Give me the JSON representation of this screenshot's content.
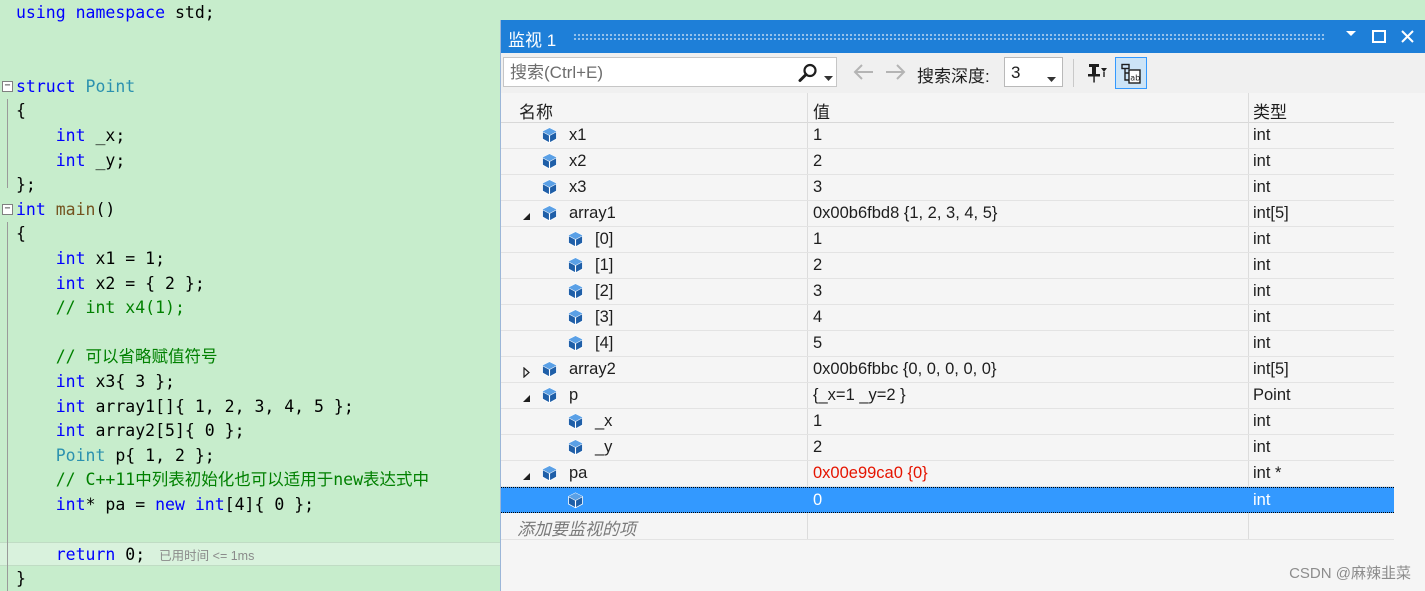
{
  "editor": {
    "lines": [
      {
        "segs": [
          {
            "t": "using",
            "c": "kw"
          },
          {
            "t": " ",
            "c": "pl"
          },
          {
            "t": "namespace",
            "c": "kw"
          },
          {
            "t": " std;",
            "c": "pl"
          }
        ]
      },
      {
        "segs": []
      },
      {
        "segs": []
      },
      {
        "segs": [
          {
            "t": "struct",
            "c": "kw"
          },
          {
            "t": " ",
            "c": "pl"
          },
          {
            "t": "Point",
            "c": "ty"
          }
        ],
        "fold": "−"
      },
      {
        "segs": [
          {
            "t": "{",
            "c": "pl"
          }
        ]
      },
      {
        "segs": [
          {
            "t": "    ",
            "c": "pl"
          },
          {
            "t": "int",
            "c": "kw"
          },
          {
            "t": " _x;",
            "c": "pl"
          }
        ]
      },
      {
        "segs": [
          {
            "t": "    ",
            "c": "pl"
          },
          {
            "t": "int",
            "c": "kw"
          },
          {
            "t": " _y;",
            "c": "pl"
          }
        ]
      },
      {
        "segs": [
          {
            "t": "};",
            "c": "pl"
          }
        ]
      },
      {
        "segs": [
          {
            "t": "int",
            "c": "kw"
          },
          {
            "t": " ",
            "c": "pl"
          },
          {
            "t": "main",
            "c": "fn"
          },
          {
            "t": "()",
            "c": "pl"
          }
        ],
        "fold": "−"
      },
      {
        "segs": [
          {
            "t": "{",
            "c": "pl"
          }
        ]
      },
      {
        "segs": [
          {
            "t": "    ",
            "c": "pl"
          },
          {
            "t": "int",
            "c": "kw"
          },
          {
            "t": " x1 = 1;",
            "c": "pl"
          }
        ]
      },
      {
        "segs": [
          {
            "t": "    ",
            "c": "pl"
          },
          {
            "t": "int",
            "c": "kw"
          },
          {
            "t": " x2 = { 2 };",
            "c": "pl"
          }
        ]
      },
      {
        "segs": [
          {
            "t": "    // int x4(1);",
            "c": "cm"
          }
        ]
      },
      {
        "segs": []
      },
      {
        "segs": [
          {
            "t": "    // 可以省略赋值符号",
            "c": "cm"
          }
        ]
      },
      {
        "segs": [
          {
            "t": "    ",
            "c": "pl"
          },
          {
            "t": "int",
            "c": "kw"
          },
          {
            "t": " x3{ 3 };",
            "c": "pl"
          }
        ]
      },
      {
        "segs": [
          {
            "t": "    ",
            "c": "pl"
          },
          {
            "t": "int",
            "c": "kw"
          },
          {
            "t": " array1[]{ 1, 2, 3, 4, 5 };",
            "c": "pl"
          }
        ]
      },
      {
        "segs": [
          {
            "t": "    ",
            "c": "pl"
          },
          {
            "t": "int",
            "c": "kw"
          },
          {
            "t": " array2[5]{ 0 };",
            "c": "pl"
          }
        ]
      },
      {
        "segs": [
          {
            "t": "    ",
            "c": "pl"
          },
          {
            "t": "Point",
            "c": "ty"
          },
          {
            "t": " p{ 1, 2 };",
            "c": "pl"
          }
        ]
      },
      {
        "segs": [
          {
            "t": "    // C++11中列表初始化也可以适用于new表达式中",
            "c": "cm"
          }
        ]
      },
      {
        "segs": [
          {
            "t": "    ",
            "c": "pl"
          },
          {
            "t": "int",
            "c": "kw"
          },
          {
            "t": "* pa = ",
            "c": "pl"
          },
          {
            "t": "new",
            "c": "kw"
          },
          {
            "t": " ",
            "c": "pl"
          },
          {
            "t": "int",
            "c": "kw"
          },
          {
            "t": "[4]{ 0 };",
            "c": "pl"
          }
        ]
      },
      {
        "segs": []
      },
      {
        "segs": [
          {
            "t": "    ",
            "c": "pl"
          },
          {
            "t": "return",
            "c": "kw"
          },
          {
            "t": " 0;",
            "c": "pl"
          }
        ],
        "current": true,
        "elapsed": "已用时间 <= 1ms"
      },
      {
        "segs": [
          {
            "t": "}",
            "c": "pl"
          }
        ]
      }
    ]
  },
  "watch": {
    "title": "监视 1",
    "search_placeholder": "搜索(Ctrl+E)",
    "depth_label": "搜索深度:",
    "depth_value": "3",
    "columns": {
      "name": "名称",
      "value": "值",
      "type": "类型"
    },
    "add_item": "添加要监视的项",
    "rows": [
      {
        "level": 0,
        "exp": "",
        "name": "x1",
        "value": "1",
        "type": "int"
      },
      {
        "level": 0,
        "exp": "",
        "name": "x2",
        "value": "2",
        "type": "int"
      },
      {
        "level": 0,
        "exp": "",
        "name": "x3",
        "value": "3",
        "type": "int"
      },
      {
        "level": 0,
        "exp": "open",
        "name": "array1",
        "value": "0x00b6fbd8 {1, 2, 3, 4, 5}",
        "type": "int[5]"
      },
      {
        "level": 1,
        "exp": "",
        "name": "[0]",
        "value": "1",
        "type": "int"
      },
      {
        "level": 1,
        "exp": "",
        "name": "[1]",
        "value": "2",
        "type": "int"
      },
      {
        "level": 1,
        "exp": "",
        "name": "[2]",
        "value": "3",
        "type": "int"
      },
      {
        "level": 1,
        "exp": "",
        "name": "[3]",
        "value": "4",
        "type": "int"
      },
      {
        "level": 1,
        "exp": "",
        "name": "[4]",
        "value": "5",
        "type": "int"
      },
      {
        "level": 0,
        "exp": "closed",
        "name": "array2",
        "value": "0x00b6fbbc {0, 0, 0, 0, 0}",
        "type": "int[5]"
      },
      {
        "level": 0,
        "exp": "open",
        "name": "p",
        "value": "{_x=1 _y=2 }",
        "type": "Point"
      },
      {
        "level": 1,
        "exp": "",
        "name": "_x",
        "value": "1",
        "type": "int"
      },
      {
        "level": 1,
        "exp": "",
        "name": "_y",
        "value": "2",
        "type": "int"
      },
      {
        "level": 0,
        "exp": "open",
        "name": "pa",
        "value": "0x00e99ca0 {0}",
        "type": "int *",
        "changed": true
      },
      {
        "level": 1,
        "exp": "",
        "name": "",
        "value": "0",
        "type": "int",
        "selected": true
      }
    ]
  },
  "watermark": "CSDN @麻辣韭菜",
  "colors": {
    "titlebar": "#1e7fd8",
    "selection": "#3399ff",
    "editor_bg": "#c7edcc",
    "changed_value": "#e51400"
  }
}
